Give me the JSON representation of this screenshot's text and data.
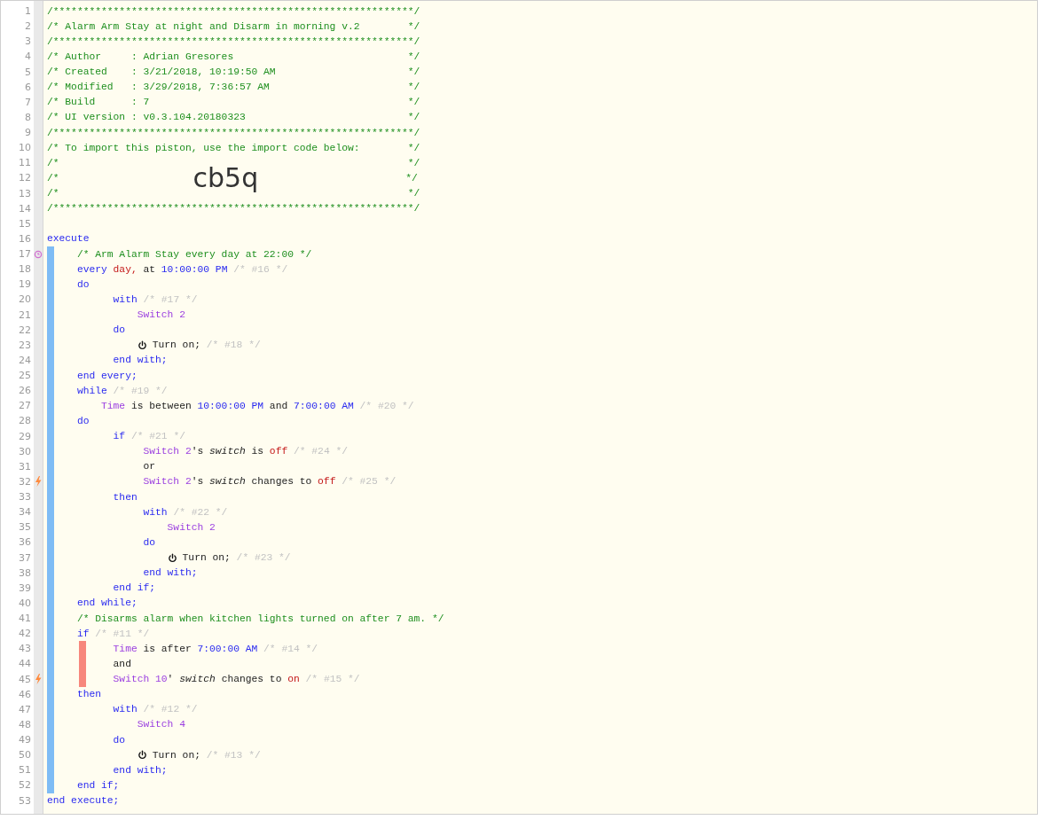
{
  "header": [
    {
      "n": "1",
      "tokens": [
        {
          "kind": "comment",
          "text": "/************************************************************/"
        }
      ]
    },
    {
      "n": "2",
      "tokens": [
        {
          "kind": "comment",
          "text": "/* Alarm Arm Stay at night and Disarm in morning v.2        */"
        }
      ]
    },
    {
      "n": "3",
      "tokens": [
        {
          "kind": "comment",
          "text": "/************************************************************/"
        }
      ]
    },
    {
      "n": "4",
      "tokens": [
        {
          "kind": "comment",
          "text": "/* Author     : Adrian Gresores                             */"
        }
      ]
    },
    {
      "n": "5",
      "tokens": [
        {
          "kind": "comment",
          "text": "/* Created    : 3/21/2018, 10:19:50 AM                      */"
        }
      ]
    },
    {
      "n": "6",
      "tokens": [
        {
          "kind": "comment",
          "text": "/* Modified   : 3/29/2018, 7:36:57 AM                       */"
        }
      ]
    },
    {
      "n": "7",
      "tokens": [
        {
          "kind": "comment",
          "text": "/* Build      : 7                                           */"
        }
      ]
    },
    {
      "n": "8",
      "tokens": [
        {
          "kind": "comment",
          "text": "/* UI version : v0.3.104.20180323                           */"
        }
      ]
    },
    {
      "n": "9",
      "tokens": [
        {
          "kind": "comment",
          "text": "/************************************************************/"
        }
      ]
    },
    {
      "n": "10",
      "tokens": [
        {
          "kind": "comment",
          "text": "/* To import this piston, use the import code below:        */"
        }
      ]
    },
    {
      "n": "11",
      "tokens": [
        {
          "kind": "comment",
          "text": "/*                                                          */"
        }
      ]
    },
    {
      "n": "12",
      "tokens": [
        {
          "kind": "comment",
          "text": "/*"
        },
        {
          "kind": "import_code",
          "text": "cb5q"
        },
        {
          "kind": "comment",
          "text": "*/"
        }
      ]
    },
    {
      "n": "13",
      "tokens": [
        {
          "kind": "comment",
          "text": "/*                                                          */"
        }
      ]
    },
    {
      "n": "14",
      "tokens": [
        {
          "kind": "comment",
          "text": "/************************************************************/"
        }
      ]
    },
    {
      "n": "15"
    },
    {
      "n": "16",
      "tokens": [
        {
          "kind": "keyword",
          "text": "execute"
        }
      ]
    }
  ],
  "body": [
    {
      "n": "17",
      "kind": "timer",
      "failed": false,
      "tokens": [
        {
          "kind": "comment",
          "text": "     /* Arm Alarm Stay every day at 22:00 */"
        }
      ]
    },
    {
      "n": "18",
      "kind": "plain",
      "failed": false,
      "tokens": [
        {
          "kind": "keyword",
          "text": "     every"
        },
        {
          "kind": "red",
          "text": " day,"
        },
        {
          "kind": "text",
          "text": " at "
        },
        {
          "kind": "value",
          "text": "10:00:00 PM"
        },
        {
          "kind": "faint",
          "text": " /* #16 */"
        }
      ]
    },
    {
      "n": "19",
      "kind": "plain",
      "failed": false,
      "tokens": [
        {
          "kind": "keyword",
          "text": "     do"
        }
      ]
    },
    {
      "n": "20",
      "kind": "plain",
      "failed": false,
      "tokens": [
        {
          "kind": "keyword",
          "text": "           with"
        },
        {
          "kind": "faint",
          "text": " /* #17 */"
        }
      ]
    },
    {
      "n": "21",
      "kind": "plain",
      "failed": false,
      "tokens": [
        {
          "kind": "device",
          "text": "               Switch 2"
        }
      ]
    },
    {
      "n": "22",
      "kind": "plain",
      "failed": false,
      "tokens": [
        {
          "kind": "keyword",
          "text": "           do"
        }
      ]
    },
    {
      "n": "23",
      "kind": "plain",
      "failed": false,
      "tokens": [
        {
          "kind": "action",
          "text": "               Turn on;"
        },
        {
          "kind": "faint",
          "text": " /* #18 */"
        }
      ]
    },
    {
      "n": "24",
      "kind": "plain",
      "failed": false,
      "tokens": [
        {
          "kind": "keyword",
          "text": "           end with;"
        }
      ]
    },
    {
      "n": "25",
      "kind": "plain",
      "failed": false,
      "tokens": [
        {
          "kind": "keyword",
          "text": "     end every;"
        }
      ]
    },
    {
      "n": "26",
      "kind": "plain",
      "failed": false,
      "tokens": [
        {
          "kind": "keyword",
          "text": "     while"
        },
        {
          "kind": "faint",
          "text": " /* #19 */"
        }
      ]
    },
    {
      "n": "27",
      "kind": "plain",
      "failed": false,
      "tokens": [
        {
          "kind": "device",
          "text": "         Time"
        },
        {
          "kind": "text",
          "text": " is between "
        },
        {
          "kind": "value",
          "text": "10:00:00 PM"
        },
        {
          "kind": "text",
          "text": " and "
        },
        {
          "kind": "value",
          "text": "7:00:00 AM"
        },
        {
          "kind": "faint",
          "text": " /* #20 */"
        }
      ]
    },
    {
      "n": "28",
      "kind": "plain",
      "failed": false,
      "tokens": [
        {
          "kind": "keyword",
          "text": "     do"
        }
      ]
    },
    {
      "n": "29",
      "kind": "plain",
      "failed": false,
      "tokens": [
        {
          "kind": "keyword",
          "text": "           if"
        },
        {
          "kind": "faint",
          "text": " /* #21 */"
        }
      ]
    },
    {
      "n": "30",
      "kind": "plain",
      "failed": false,
      "tokens": [
        {
          "kind": "device",
          "text": "                Switch 2"
        },
        {
          "kind": "text",
          "text": "'s "
        },
        {
          "kind": "italic",
          "text": "switch"
        },
        {
          "kind": "text",
          "text": " is "
        },
        {
          "kind": "red",
          "text": "off"
        },
        {
          "kind": "faint",
          "text": " /* #24 */"
        }
      ]
    },
    {
      "n": "31",
      "kind": "plain",
      "failed": false,
      "tokens": [
        {
          "kind": "text",
          "text": "                or"
        }
      ]
    },
    {
      "n": "32",
      "kind": "trigger",
      "failed": false,
      "tokens": [
        {
          "kind": "device",
          "text": "                Switch 2"
        },
        {
          "kind": "text",
          "text": "'s "
        },
        {
          "kind": "italic",
          "text": "switch"
        },
        {
          "kind": "text",
          "text": " changes to "
        },
        {
          "kind": "red",
          "text": "off"
        },
        {
          "kind": "faint",
          "text": " /* #25 */"
        }
      ]
    },
    {
      "n": "33",
      "kind": "plain",
      "failed": false,
      "tokens": [
        {
          "kind": "keyword",
          "text": "           then"
        }
      ]
    },
    {
      "n": "34",
      "kind": "plain",
      "failed": false,
      "tokens": [
        {
          "kind": "keyword",
          "text": "                with"
        },
        {
          "kind": "faint",
          "text": " /* #22 */"
        }
      ]
    },
    {
      "n": "35",
      "kind": "plain",
      "failed": false,
      "tokens": [
        {
          "kind": "device",
          "text": "                    Switch 2"
        }
      ]
    },
    {
      "n": "36",
      "kind": "plain",
      "failed": false,
      "tokens": [
        {
          "kind": "keyword",
          "text": "                do"
        }
      ]
    },
    {
      "n": "37",
      "kind": "plain",
      "failed": false,
      "tokens": [
        {
          "kind": "action",
          "text": "                    Turn on;"
        },
        {
          "kind": "faint",
          "text": " /* #23 */"
        }
      ]
    },
    {
      "n": "38",
      "kind": "plain",
      "failed": false,
      "tokens": [
        {
          "kind": "keyword",
          "text": "                end with;"
        }
      ]
    },
    {
      "n": "39",
      "kind": "plain",
      "failed": false,
      "tokens": [
        {
          "kind": "keyword",
          "text": "           end if;"
        }
      ]
    },
    {
      "n": "40",
      "kind": "plain",
      "failed": false,
      "tokens": [
        {
          "kind": "keyword",
          "text": "     end while;"
        }
      ]
    },
    {
      "n": "41",
      "kind": "plain",
      "failed": false,
      "tokens": [
        {
          "kind": "comment",
          "text": "     /* Disarms alarm when kitchen lights turned on after 7 am. */"
        }
      ]
    },
    {
      "n": "42",
      "kind": "plain",
      "failed": false,
      "tokens": [
        {
          "kind": "keyword",
          "text": "     if"
        },
        {
          "kind": "faint",
          "text": " /* #11 */"
        }
      ]
    },
    {
      "n": "43",
      "kind": "plain",
      "failed": true,
      "tokens": [
        {
          "kind": "device",
          "text": "           Time"
        },
        {
          "kind": "text",
          "text": " is after "
        },
        {
          "kind": "value",
          "text": "7:00:00 AM"
        },
        {
          "kind": "faint",
          "text": " /* #14 */"
        }
      ]
    },
    {
      "n": "44",
      "kind": "plain",
      "failed": true,
      "tokens": [
        {
          "kind": "text",
          "text": "           and"
        }
      ]
    },
    {
      "n": "45",
      "kind": "trigger",
      "failed": true,
      "tokens": [
        {
          "kind": "device",
          "text": "           Switch 10"
        },
        {
          "kind": "text",
          "text": "' "
        },
        {
          "kind": "italic",
          "text": "switch"
        },
        {
          "kind": "text",
          "text": " changes to "
        },
        {
          "kind": "red",
          "text": "on"
        },
        {
          "kind": "faint",
          "text": " /* #15 */"
        }
      ]
    },
    {
      "n": "46",
      "kind": "plain",
      "failed": false,
      "tokens": [
        {
          "kind": "keyword",
          "text": "     then"
        }
      ]
    },
    {
      "n": "47",
      "kind": "plain",
      "failed": false,
      "tokens": [
        {
          "kind": "keyword",
          "text": "           with"
        },
        {
          "kind": "faint",
          "text": " /* #12 */"
        }
      ]
    },
    {
      "n": "48",
      "kind": "plain",
      "failed": false,
      "tokens": [
        {
          "kind": "device",
          "text": "               Switch 4"
        }
      ]
    },
    {
      "n": "49",
      "kind": "plain",
      "failed": false,
      "tokens": [
        {
          "kind": "keyword",
          "text": "           do"
        }
      ]
    },
    {
      "n": "50",
      "kind": "plain",
      "failed": false,
      "tokens": [
        {
          "kind": "action",
          "text": "               Turn on;"
        },
        {
          "kind": "faint",
          "text": " /* #13 */"
        }
      ]
    },
    {
      "n": "51",
      "kind": "plain",
      "failed": false,
      "tokens": [
        {
          "kind": "keyword",
          "text": "           end with;"
        }
      ]
    },
    {
      "n": "52",
      "kind": "plain",
      "failed": false,
      "tokens": [
        {
          "kind": "keyword",
          "text": "     end if;"
        }
      ]
    }
  ],
  "footer": [
    {
      "n": "53",
      "tokens": [
        {
          "kind": "keyword",
          "text": "end execute;"
        }
      ]
    }
  ]
}
